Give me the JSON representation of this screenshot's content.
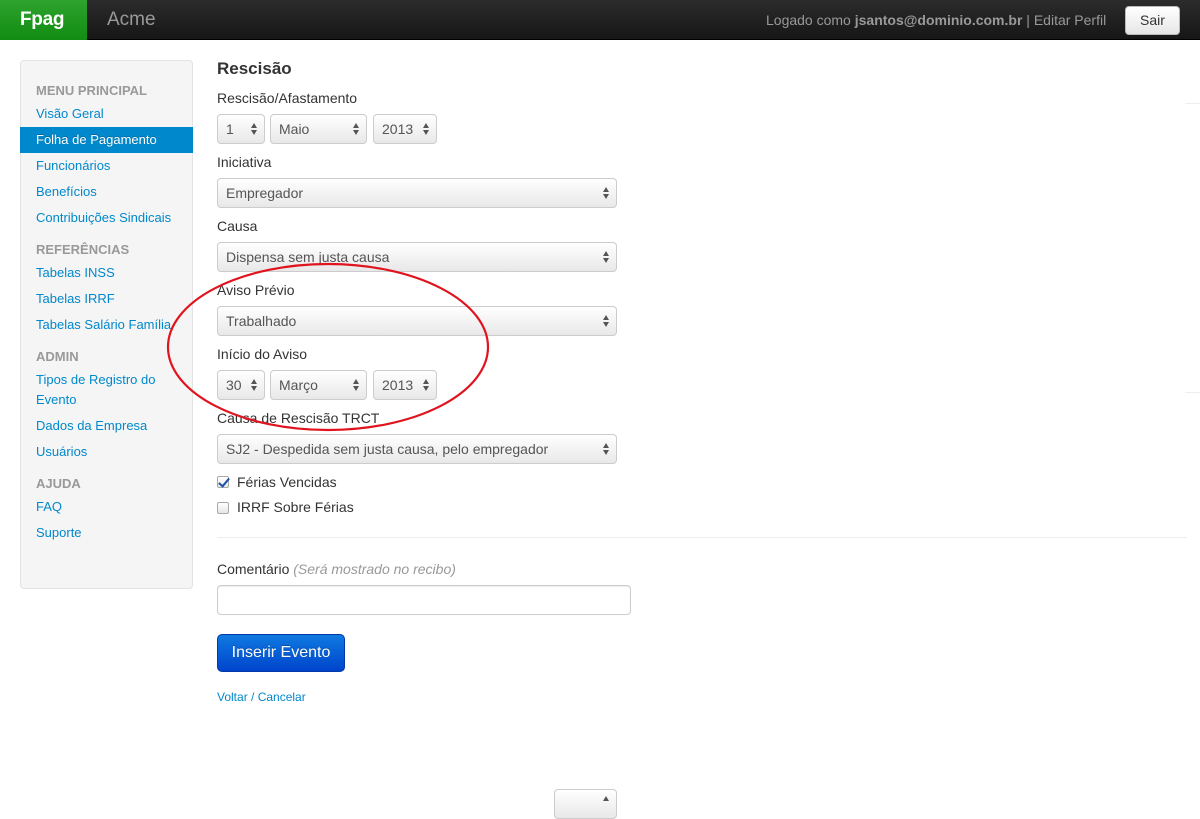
{
  "topbar": {
    "brand": "Fpag",
    "company": "Acme",
    "logged_prefix": "Logado como",
    "user_email": "jsantos@dominio.com.br",
    "separator": "|",
    "edit_profile": "Editar Perfil",
    "logout": "Sair"
  },
  "sidebar": {
    "sections": [
      {
        "header": "MENU PRINCIPAL",
        "items": [
          "Visão Geral",
          "Folha de Pagamento",
          "Funcionários",
          "Benefícios",
          "Contribuições Sindicais"
        ]
      },
      {
        "header": "REFERÊNCIAS",
        "items": [
          "Tabelas INSS",
          "Tabelas IRRF",
          "Tabelas Salário Família"
        ]
      },
      {
        "header": "ADMIN",
        "items": [
          "Tipos de Registro do Evento",
          "Dados da Empresa",
          "Usuários"
        ]
      },
      {
        "header": "AJUDA",
        "items": [
          "FAQ",
          "Suporte"
        ]
      }
    ],
    "active_item": "Folha de Pagamento"
  },
  "form": {
    "title": "Rescisão",
    "rescisao_label": "Rescisão/Afastamento",
    "rescisao_day": "1",
    "rescisao_month": "Maio",
    "rescisao_year": "2013",
    "iniciativa_label": "Iniciativa",
    "iniciativa_value": "Empregador",
    "causa_label": "Causa",
    "causa_value": "Dispensa sem justa causa",
    "aviso_label": "Aviso Prévio",
    "aviso_value": "Trabalhado",
    "inicio_label": "Início do Aviso",
    "inicio_day": "30",
    "inicio_month": "Março",
    "inicio_year": "2013",
    "trct_label": "Causa de Rescisão TRCT",
    "trct_value": "SJ2 - Despedida sem justa causa, pelo empregador",
    "ferias_vencidas_label": "Férias Vencidas",
    "ferias_vencidas_checked": true,
    "irrf_label": "IRRF Sobre Férias",
    "irrf_checked": false,
    "comentario_label": "Comentário",
    "comentario_hint": "(Será mostrado no recibo)",
    "comentario_value": "",
    "submit": "Inserir Evento",
    "cancel": "Voltar / Cancelar"
  },
  "colors": {
    "brand_green": "#159a15",
    "link_blue": "#0088cc",
    "primary_button": "#0044cc",
    "annotation_red": "#e0141e"
  }
}
